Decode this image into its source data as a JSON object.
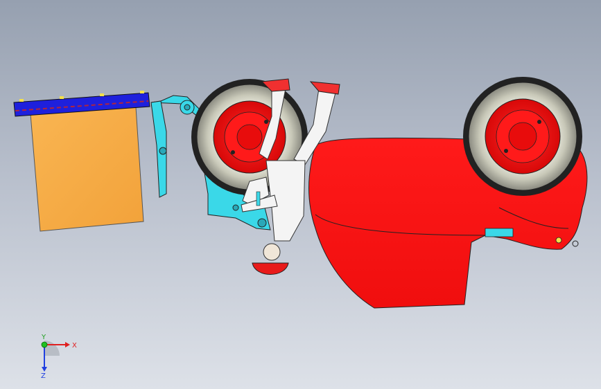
{
  "viewport": {
    "background_top": "#96a0b0",
    "background_bottom": "#dde1e8"
  },
  "model": {
    "body_color": "#ff1414",
    "frame_color": "#3ad8e8",
    "bucket_color": "#f6ad45",
    "bucket_bar_color": "#1e20dc",
    "tire_color": "#d8d8c8",
    "rim_color": "#ff1414"
  },
  "triad": {
    "x_label": "X",
    "y_label": "Y",
    "z_label": "Z",
    "x_color": "#e02020",
    "y_color": "#20c020",
    "z_color": "#2040e0"
  }
}
